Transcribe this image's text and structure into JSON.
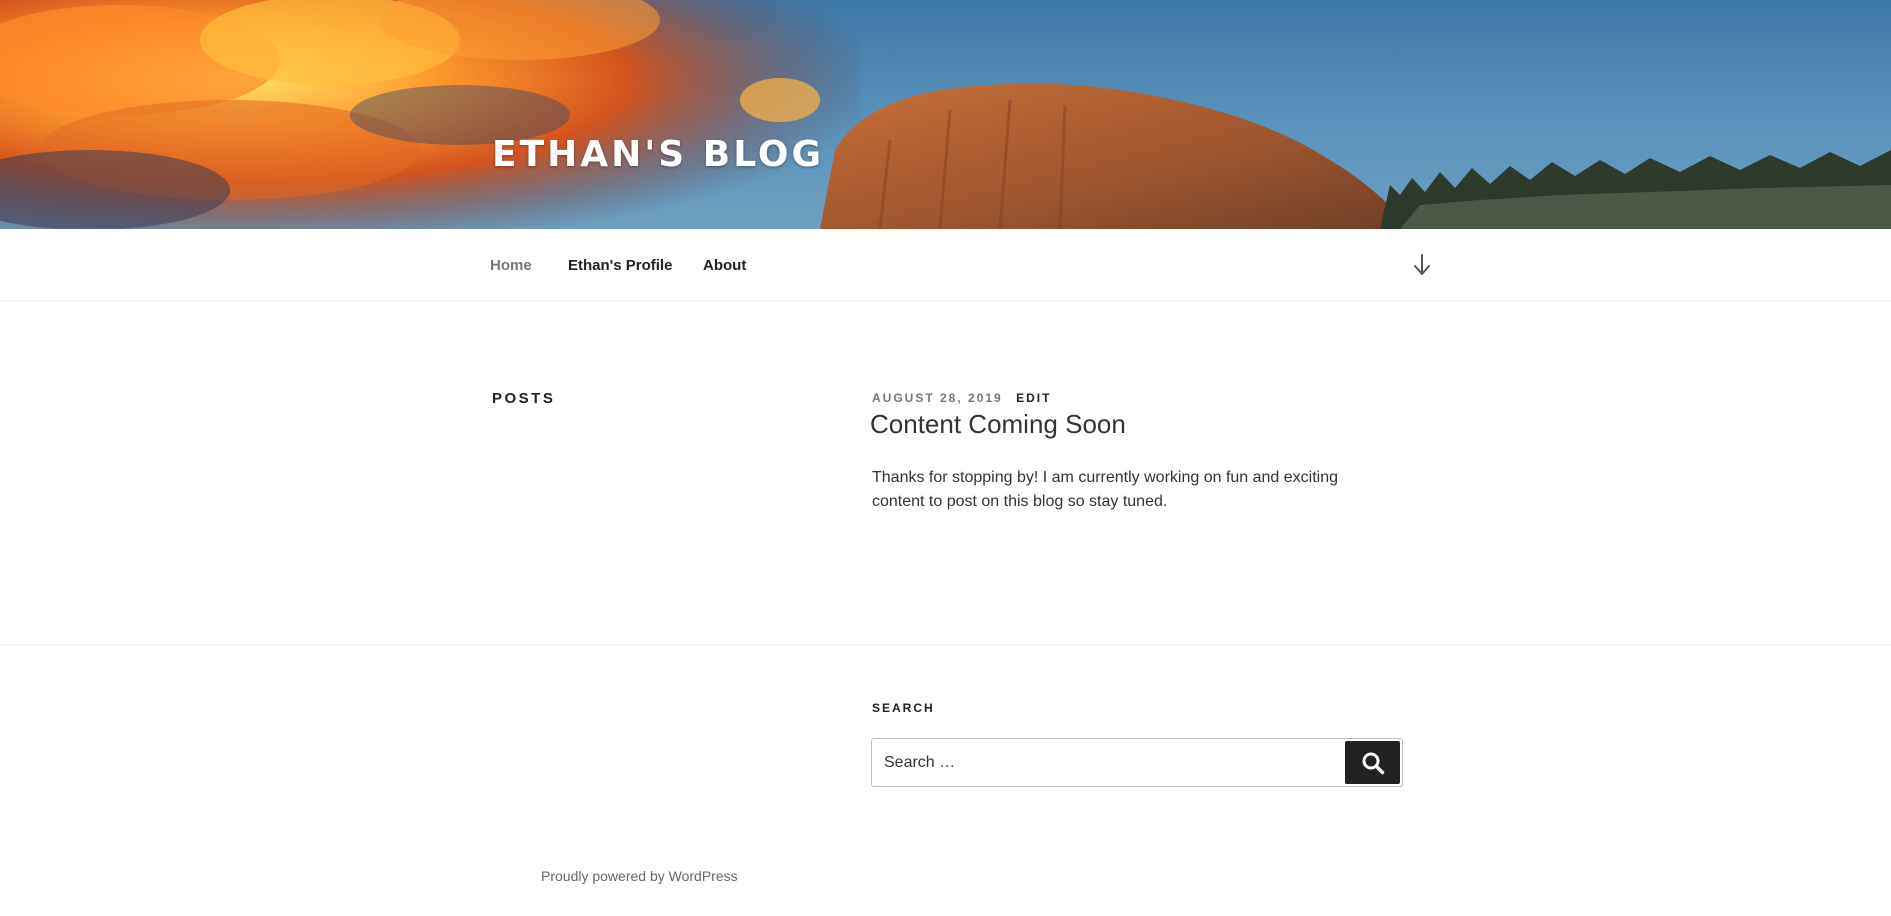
{
  "header": {
    "site_title": "ETHAN'S BLOG"
  },
  "nav": {
    "items": [
      {
        "label": "Home",
        "current": true
      },
      {
        "label": "Ethan's Profile",
        "current": false
      },
      {
        "label": "About",
        "current": false
      }
    ],
    "scroll_icon": "arrow-down-icon"
  },
  "main": {
    "section_heading": "POSTS",
    "post": {
      "date": "AUGUST 28, 2019",
      "edit_label": "EDIT",
      "title": "Content Coming Soon",
      "excerpt": "Thanks for stopping by! I am currently working on fun and exciting content to post on this blog so stay tuned."
    }
  },
  "footer": {
    "search_widget_title": "SEARCH",
    "search_placeholder": "Search …",
    "search_value": "",
    "search_icon": "search-icon",
    "credit": "Proudly powered by WordPress"
  },
  "colors": {
    "text_dark": "#222222",
    "text_body": "#333333",
    "text_muted": "#767676",
    "button_bg": "#222222",
    "border": "#eeeeee"
  }
}
